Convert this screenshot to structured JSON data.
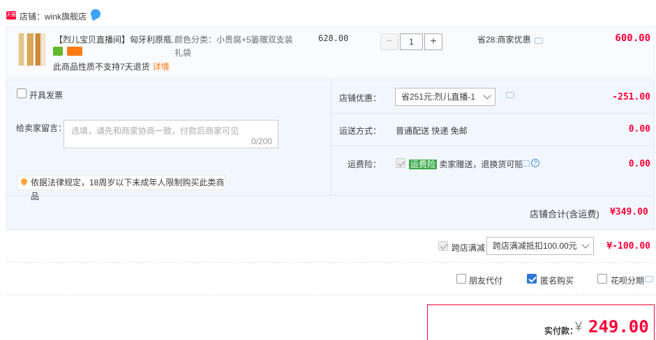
{
  "shop": {
    "badge": "天猫",
    "label": "店铺：wink旗舰店"
  },
  "item": {
    "title": "【烈儿宝贝直播间】匈牙利原瓶...",
    "no_return": "此商品性质不支持7天退货",
    "detail_link": "详情",
    "color_spec": "颜色分类：小贵腐+5篓赠双支装礼袋",
    "price": "628.00",
    "quantity": "1",
    "minus": "−",
    "plus": "+",
    "discount": "省28:商家优惠",
    "total": "600.00"
  },
  "options": {
    "invoice_label": "开具发票",
    "note_label": "给卖家留言：",
    "note_placeholder": "选填，请先和商家协商一致，付款后商家可见",
    "note_count": "0/200",
    "law_notice": "依据法律规定，18周岁以下未成年人限制购买此类商品",
    "shop_discount_label": "店铺优惠：",
    "shop_discount_select": "省251元:烈儿直播-1",
    "shop_discount_value": "-251.00",
    "shipping_label": "运送方式：",
    "shipping_method": "普通配送 快递 免邮",
    "shipping_value": "0.00",
    "insurance_label": "运费险：",
    "insurance_tag": "运费险",
    "insurance_text": "卖家赠送，退换货可赔",
    "insurance_value": "0.00"
  },
  "shop_total": {
    "label": "店铺合计(含运费)",
    "value": "¥349.00"
  },
  "cross_shop": {
    "label": "跨店满减",
    "select": "跨店满减抵扣100.00元",
    "value": "¥-100.00"
  },
  "extras": {
    "friend_pay": "朋友代付",
    "anonymous": "匿名购买",
    "huabei": "花呗分期"
  },
  "payment": {
    "label": "实付款：",
    "currency": "¥",
    "amount": "249.00"
  },
  "colors": {
    "accent_red": "#ff0036",
    "link_orange": "#ff7a12",
    "panel_blue": "#f2f7ff",
    "check_blue": "#2f74d8"
  }
}
